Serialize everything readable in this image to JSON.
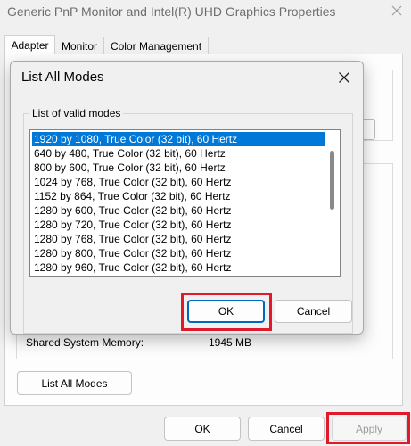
{
  "window": {
    "title": "Generic PnP Monitor and Intel(R) UHD Graphics Properties",
    "close_icon": "close-icon"
  },
  "tabs": [
    {
      "label": "Adapter",
      "active": true
    },
    {
      "label": "Monitor",
      "active": false
    },
    {
      "label": "Color Management",
      "active": false
    }
  ],
  "adapter_info": {
    "shared_memory_label": "Shared System Memory:",
    "shared_memory_value": "1945 MB",
    "list_all_modes_label": "List All Modes"
  },
  "footer": {
    "ok_label": "OK",
    "cancel_label": "Cancel",
    "apply_label": "Apply",
    "apply_enabled": false
  },
  "dialog": {
    "title": "List All Modes",
    "group_label": "List of valid modes",
    "modes": [
      "1920 by 1080, True Color (32 bit), 60 Hertz",
      "640 by 480, True Color (32 bit), 60 Hertz",
      "800 by 600, True Color (32 bit), 60 Hertz",
      "1024 by 768, True Color (32 bit), 60 Hertz",
      "1152 by 864, True Color (32 bit), 60 Hertz",
      "1280 by 600, True Color (32 bit), 60 Hertz",
      "1280 by 720, True Color (32 bit), 60 Hertz",
      "1280 by 768, True Color (32 bit), 60 Hertz",
      "1280 by 800, True Color (32 bit), 60 Hertz",
      "1280 by 960, True Color (32 bit), 60 Hertz"
    ],
    "selected_index": 0,
    "ok_label": "OK",
    "cancel_label": "Cancel"
  },
  "colors": {
    "selection": "#0078d7",
    "highlight_box": "#e01a2b",
    "default_button_border": "#0067c0"
  }
}
